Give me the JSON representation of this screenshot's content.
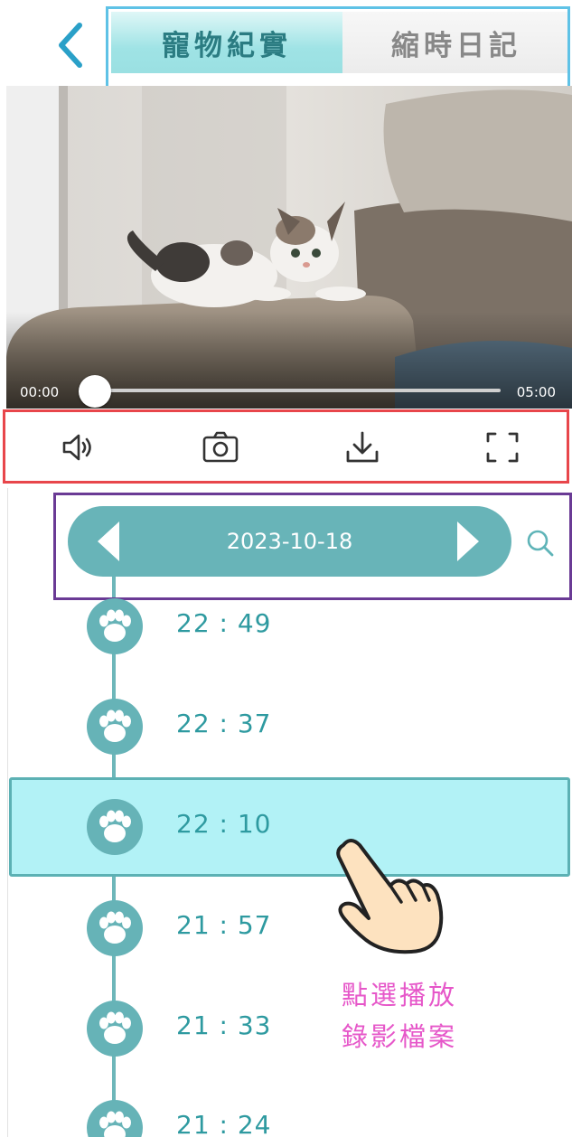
{
  "header": {
    "back_icon": "chevron-left-icon",
    "tabs": [
      {
        "label": "寵物紀實",
        "active": true
      },
      {
        "label": "縮時日記",
        "active": false
      }
    ],
    "accent_color": "#5fc2e6"
  },
  "player": {
    "time_start": "00:00",
    "time_end": "05:00",
    "progress": 0.0
  },
  "controls": {
    "icons": [
      "speaker-icon",
      "camera-icon",
      "download-icon",
      "fullscreen-icon"
    ],
    "frame_color": "#e8464b"
  },
  "date_bar": {
    "date": "2023-10-18",
    "frame_color": "#6a3a95",
    "pill_color": "#68b4b8"
  },
  "timeline": {
    "entries": [
      {
        "time": "22 : 49",
        "selected": false
      },
      {
        "time": "22 : 37",
        "selected": false
      },
      {
        "time": "22 : 10",
        "selected": true
      },
      {
        "time": "21 : 57",
        "selected": false
      },
      {
        "time": "21 : 33",
        "selected": false
      },
      {
        "time": "21 : 24",
        "selected": false
      }
    ],
    "paw_icon": "paw-icon",
    "highlight_color": "#b2f2f6"
  },
  "annotation": {
    "line1": "點選播放",
    "line2": "錄影檔案",
    "color": "#e657c9"
  }
}
